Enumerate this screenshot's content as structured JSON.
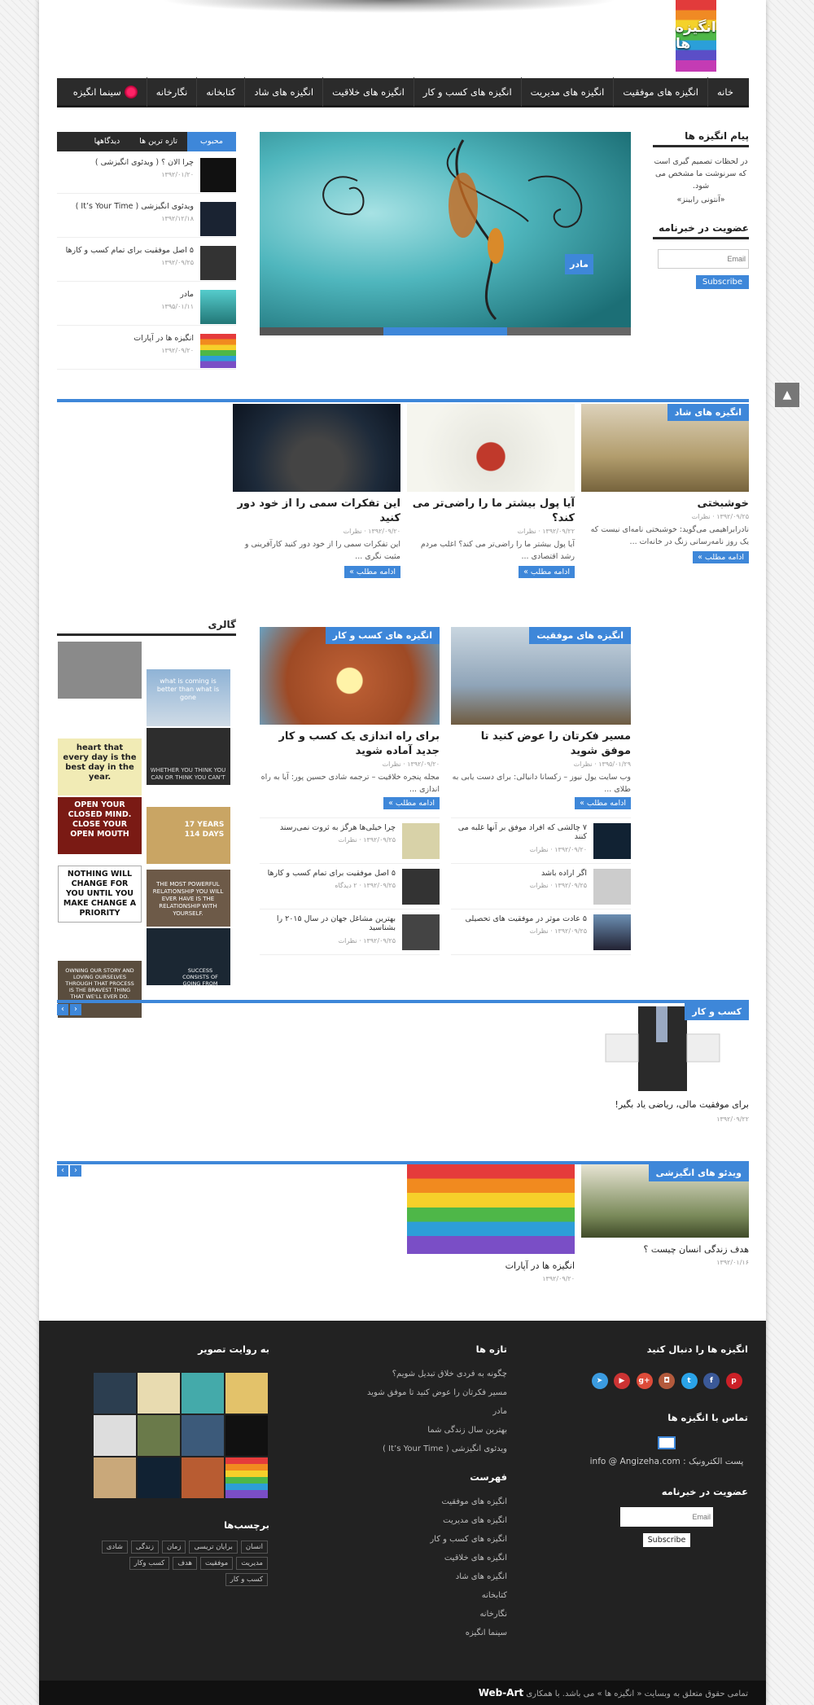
{
  "logo": {
    "text": "انگیزه ها"
  },
  "nav": [
    "خانه",
    "انگیزه های موفقیت",
    "انگیزه های مدیریت",
    "انگیزه های کسب و کار",
    "انگیزه های خلاقیت",
    "انگیزه های شاد",
    "کتابخانه",
    "نگارخانه",
    "سینما انگیزه"
  ],
  "right_sidebar": {
    "quote_title": "پیام انگیزه ها",
    "quote": "در لحظات تصمیم گیری است که سرنوشت ما مشخص می شود.",
    "quote_author": "«آنتونی رابینز»",
    "newsletter_title": "عضویت در خبرنامه",
    "email_placeholder": "Email",
    "subscribe": "Subscribe"
  },
  "slider": {
    "caption": "مادر"
  },
  "tabs": {
    "popular": "محبوب",
    "recent": "تازه ترین ها",
    "comments": "دیدگاهها"
  },
  "left_list": [
    {
      "title": "چرا الان ؟ ( ویدئوی انگیزشی )",
      "date": "۱۳۹۲/۰۱/۲۰"
    },
    {
      "title": "ویدئوی انگیزشی ( It’s Your Time )",
      "date": "۱۳۹۲/۱۲/۱۸"
    },
    {
      "title": "۵ اصل موفقیت برای تمام کسب و کارها",
      "date": "۱۳۹۲/۰۹/۲۵"
    },
    {
      "title": "مادر",
      "date": "۱۳۹۵/۰۱/۱۱"
    },
    {
      "title": "انگیزه ها در آپارات",
      "date": "۱۳۹۲/۰۹/۲۰"
    }
  ],
  "happy": {
    "badge": "انگیزه های شاد",
    "posts": [
      {
        "title": "خوشبختی",
        "date": "۱۳۹۲/۰۹/۲۵",
        "comments": "نظرات",
        "excerpt": "نادرابراهیمی می‌گوید: خوشبختی نامه‌ای نیست که یک روز نامه‌رسانی زنگ در خانه‌ات ...",
        "more": "ادامه مطلب »"
      },
      {
        "title": "آیا پول بیشتر ما را راضی‌تر می کند؟",
        "date": "۱۳۹۲/۰۹/۲۲",
        "comments": "نظرات",
        "excerpt": "آیا پول بیشتر ما را راضی‌تر می کند؟ اغلب مردم رشد اقتصادی ...",
        "more": "ادامه مطلب »"
      },
      {
        "title": "این تفکرات سمی را از خود دور کنید",
        "date": "۱۳۹۲/۰۹/۲۰",
        "comments": "نظرات",
        "excerpt": "این تفکرات سمی را از خود دور کنید کارآفرینی و مثبت نگری ...",
        "more": "ادامه مطلب »"
      }
    ]
  },
  "gallery_title": "گالری",
  "success": {
    "badge": "انگیزه های موفقیت",
    "title": "مسیر فکرتان را عوض کنید تا موفق شوید",
    "date": "۱۳۹۵/۰۱/۲۹",
    "comments": "نظرات",
    "excerpt": "وب سایت یول نیوز – زکسانا دانیالی: برای دست یابی به طلای ...",
    "more": "ادامه مطلب »",
    "list": [
      {
        "title": "۷ چالشی که افراد موفق بر آنها غلبه می کنند",
        "date": "۱۳۹۲/۰۹/۲۰",
        "c": "نظرات"
      },
      {
        "title": "اگر اراده باشد",
        "date": "۱۳۹۲/۰۹/۲۵",
        "c": "نظرات"
      },
      {
        "title": "۵ عادت موثر در موفقیت های تحصیلی",
        "date": "۱۳۹۲/۰۹/۲۵",
        "c": "نظرات"
      }
    ]
  },
  "business": {
    "badge": "انگیزه های کسب و کار",
    "title": "برای راه اندازی یک کسب و کار جدید آماده شوید",
    "date": "۱۳۹۲/۰۹/۲۰",
    "comments": "نظرات",
    "excerpt": "مجله پنجره خلاقیت – ترجمه شادی حسین پور: آیا به راه اندازی ...",
    "more": "ادامه مطلب »",
    "list": [
      {
        "title": "چرا خیلی‌ها هرگز به ثروت نمی‌رسند",
        "date": "۱۳۹۲/۰۹/۲۵",
        "c": "نظرات"
      },
      {
        "title": "۵ اصل موفقیت برای تمام کسب و کارها",
        "date": "۱۳۹۲/۰۹/۲۵",
        "c": "۲ دیدگاه"
      },
      {
        "title": "بهترین مشاغل جهان در سال ۲۰۱۵ را بشناسید",
        "date": "۱۳۹۲/۰۹/۲۵",
        "c": "نظرات"
      }
    ]
  },
  "gallery_texts": [
    "what is coming is better than what is gone",
    "heart that every day is the best day in the year.",
    "WHETHER YOU THINK YOU CAN OR THINK YOU CAN'T",
    "OPEN YOUR CLOSED MIND. CLOSE YOUR OPEN MOUTH",
    "17 YEARS 114 DAYS",
    "NOTHING WILL CHANGE FOR YOU UNTIL YOU MAKE CHANGE A PRIORITY",
    "THE MOST POWERFUL RELATIONSHIP YOU WILL EVER HAVE IS THE RELATIONSHIP WITH YOURSELF.",
    "OWNING OUR STORY AND LOVING OURSELVES THROUGH THAT PROCESS IS THE BRAVEST THING THAT WE'LL EVER DO.",
    "SUCCESS CONSISTS OF GOING FROM FAILURE TO FAILURE"
  ],
  "biz2": {
    "badge": "کسب و کار",
    "title": "برای موفقیت مالی، ریاضی یاد بگیر!",
    "date": "۱۳۹۲/۰۹/۲۲"
  },
  "video": {
    "badge": "ویدئو های انگیزشی",
    "posts": [
      {
        "title": "هدف زندگی انسان چیست ؟",
        "date": "۱۳۹۲/۰۱/۱۶"
      },
      {
        "title": "انگیزه ها در آپارات",
        "date": "۱۳۹۲/۰۹/۲۰"
      }
    ]
  },
  "footer": {
    "follow": "انگیزه ها را دنبال کنید",
    "contact": "تماس با انگیزه ها",
    "email_label": "پست الکترونیک : info @ Angizeha.com",
    "newsletter": "عضویت در خبرنامه",
    "email_placeholder": "Email",
    "subscribe": "Subscribe",
    "recent_title": "تازه ها",
    "recent": [
      "چگونه به فردی خلاق تبدیل شویم؟",
      "مسیر فکرتان را عوض کنید تا موفق شوید",
      "مادر",
      "بهترین سال زندگی شما",
      "ویدئوی انگیزشی ( It’s Your Time )"
    ],
    "menu_title": "فهرست",
    "menu": [
      "انگیزه های موفقیت",
      "انگیزه های مدیریت",
      "انگیزه های کسب و کار",
      "انگیزه های خلاقیت",
      "انگیزه های شاد",
      "کتابخانه",
      "نگارخانه",
      "سینما انگیزه"
    ],
    "photos_title": "به روایت تصویر",
    "tags_title": "برچسب‌ها",
    "tags": [
      "انسان",
      "برایان تریسی",
      "زمان",
      "زندگی",
      "شادی",
      "مدیریت",
      "موفقیت",
      "هدف",
      "کسب وکار",
      "کسب و کار"
    ],
    "copyright": "تمامی حقوق متعلق به وبسایت « انگیزه ها » می باشد. با همکاری",
    "brand": "Web-Art"
  },
  "colors": {
    "accent": "#3e87d9",
    "nav": "#2b2b2b",
    "footer": "#222222"
  }
}
